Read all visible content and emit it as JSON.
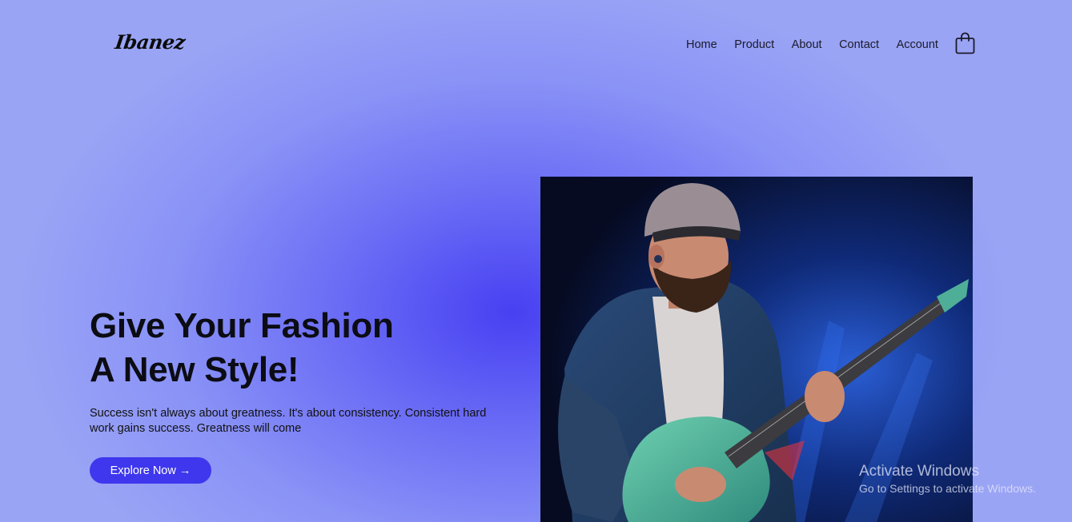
{
  "brand": {
    "logo_text": "Ibanez"
  },
  "nav": {
    "items": [
      "Home",
      "Product",
      "About",
      "Contact",
      "Account"
    ],
    "cart_icon": "shopping-bag-icon"
  },
  "hero": {
    "title_line1": "Give Your Fashion",
    "title_line2": "A New Style!",
    "subtitle": "Success isn't always about greatness. It's about consistency. Consistent hard work gains success. Greatness will come",
    "cta_label": "Explore Now →",
    "image": "guitarist-playing-electric-guitar-photo"
  },
  "os_watermark": {
    "line1": "Activate Windows",
    "line2": "Go to Settings to activate Windows."
  },
  "colors": {
    "accent": "#3e37ee",
    "background_center": "#4740f2",
    "background_edge": "#9aa4f5"
  }
}
